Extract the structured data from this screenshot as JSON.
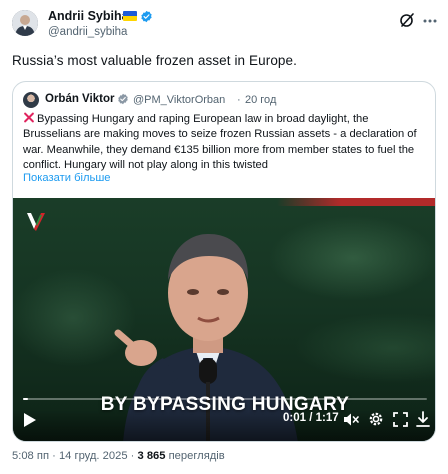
{
  "author": {
    "name": "Andrii Sybiha",
    "handle": "@andrii_sybiha",
    "flag_icon": "ukraine-flag-icon",
    "verified_icon": "verified-badge-icon"
  },
  "post": {
    "text": "Russia’s most valuable frozen asset in Europe."
  },
  "quoted": {
    "name": "Orbán Viktor",
    "handle": "@PM_ViktorOrban",
    "separator": "·",
    "time": "20 год",
    "body": "Bypassing Hungary and raping European law in broad daylight, the Brusselians are making moves to seize frozen Russian assets - a declaration of war. Meanwhile, they demand €135 billion more from member states to fuel the conflict. Hungary will not play along in this twisted",
    "show_more": "Показати більше",
    "video": {
      "caption": "BY BYPASSING HUNGARY",
      "current_time": "0:01",
      "duration": "1:17",
      "time_separator": " / ",
      "progress_fraction": 0.013
    }
  },
  "footer": {
    "time": "5:08 пп",
    "separator": " · ",
    "date": "14 груд. 2025",
    "views_count": "3 865",
    "views_label": " переглядів"
  },
  "colors": {
    "text": "#0f1419",
    "muted": "#536471",
    "link": "#1d9bf0",
    "verified": "#1d9bf0",
    "border": "#cfd9de"
  }
}
